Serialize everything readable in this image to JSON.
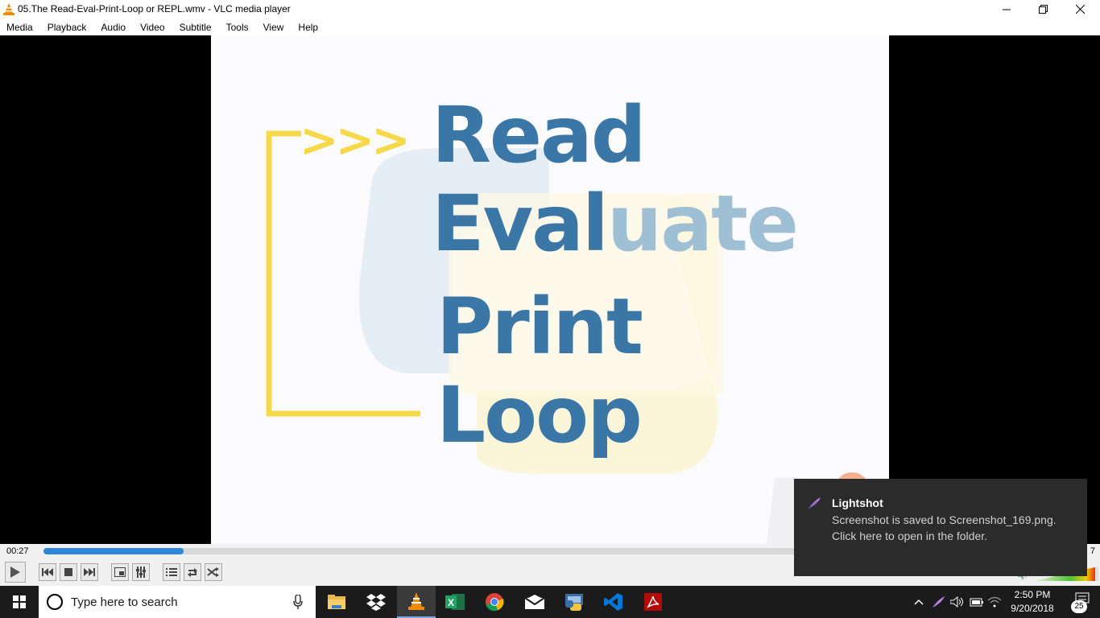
{
  "window": {
    "title": "05.The Read-Eval-Print-Loop or REPL.wmv - VLC media player"
  },
  "menu": {
    "items": [
      "Media",
      "Playback",
      "Audio",
      "Video",
      "Subtitle",
      "Tools",
      "View",
      "Help"
    ]
  },
  "video": {
    "prompt": ">>>",
    "word_read": "Read",
    "word_evaluate_main": "Eval",
    "word_evaluate_fade": "uate",
    "word_print": "Print",
    "word_loop": "Loop"
  },
  "player": {
    "elapsed": "00:27",
    "total_partial": "7",
    "progress_fraction": 0.135,
    "volume_fraction": 0.95
  },
  "taskbar": {
    "search_placeholder": "Type here to search",
    "apps": [
      "file-explorer-icon",
      "dropbox-icon",
      "vlc-icon",
      "excel-icon",
      "chrome-icon",
      "mail-icon",
      "python-icon",
      "vscode-icon",
      "acrobat-icon"
    ],
    "time": "2:50 PM",
    "date": "9/20/2018",
    "notification_count": "25"
  },
  "toast": {
    "title": "Lightshot",
    "body": "Screenshot is saved to Screenshot_169.png. Click here to open in the folder."
  },
  "colors": {
    "accent": "#2f86d8",
    "repl_blue": "#3b77a6",
    "repl_yellow": "#f5d94a"
  }
}
